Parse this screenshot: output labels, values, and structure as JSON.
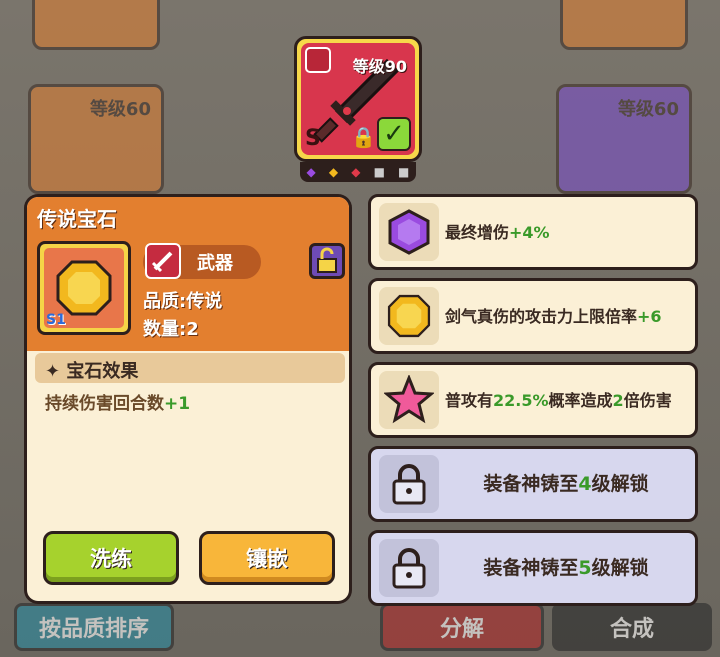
{
  "item": {
    "level_label": "等级90",
    "grade": "S"
  },
  "background": {
    "card_left_level": "等级60",
    "card_right_level": "等级60",
    "sort_button": "按品质排序",
    "decompose_button": "分解",
    "compose_button": "合成"
  },
  "panel": {
    "title": "传说宝石",
    "gem_grade": "S1",
    "type_label": "武器",
    "quality": "品质:传说",
    "count": "数量:2",
    "effect_title": "宝石效果",
    "effect_text": "持续伤害回合数",
    "effect_value": "+1",
    "wash_button": "洗练",
    "inlay_button": "镶嵌"
  },
  "slots": [
    {
      "icon": "purple-gem-icon",
      "text": "最终增伤",
      "value": "+4%"
    },
    {
      "icon": "yellow-gem-icon",
      "text": "剑气真伤的攻击力上限倍率",
      "value": "+6"
    },
    {
      "icon": "pink-star-icon",
      "pre": "普攻有",
      "v1": "22.5%",
      "mid": "概率造成",
      "v2": "2",
      "post": "倍伤害"
    },
    {
      "icon": "lock-icon",
      "pre": "装备神铸至",
      "v": "4",
      "post": "级解锁"
    },
    {
      "icon": "lock-icon",
      "pre": "装备神铸至",
      "v": "5",
      "post": "级解锁"
    }
  ],
  "colors": {
    "accent_green": "#3a9a2a",
    "panel_orange": "#e37f2f",
    "wash_green": "#a6d22d",
    "inlay_orange": "#f8b63a"
  }
}
